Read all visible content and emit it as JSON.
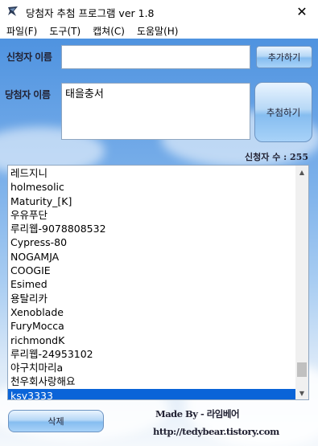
{
  "window": {
    "title": "당첨자 추첨 프로그램 ver 1.8",
    "close_glyph": "✕"
  },
  "menu": [
    {
      "label": "파일(F)"
    },
    {
      "label": "도구(T)"
    },
    {
      "label": "캡쳐(C)"
    },
    {
      "label": "도움말(H)"
    }
  ],
  "form": {
    "applicant_label": "신청자 이름",
    "applicant_value": "",
    "add_button": "추가하기",
    "winner_label": "당첨자 이름",
    "winner_value": "태을충서",
    "draw_button": "추첨하기",
    "count_label": "신청자 수 : ",
    "count_value": "255"
  },
  "list": {
    "items": [
      "레드지니",
      "holmesolic",
      "Maturity_[K]",
      "우유푸단",
      "루리웹-9078808532",
      "Cypress-80",
      "NOGAMJA",
      "COOGIE",
      "Esimed",
      "용탈리카",
      "Xenoblade",
      "FuryMocca",
      "richmondK",
      "루리웹-24953102",
      "야구치마리a",
      "천우회사랑해요",
      "ksy3333"
    ],
    "selected": "ksy3333",
    "scroll_position": 0.95
  },
  "footer": {
    "delete_button": "삭제",
    "made_by": "Made By - 라임베어",
    "url": "http://tedybear.tistory.com"
  },
  "colors": {
    "accent": "#0a64d8",
    "sky_top": "#4f93e0",
    "sky_bottom": "#f4f8fc"
  }
}
